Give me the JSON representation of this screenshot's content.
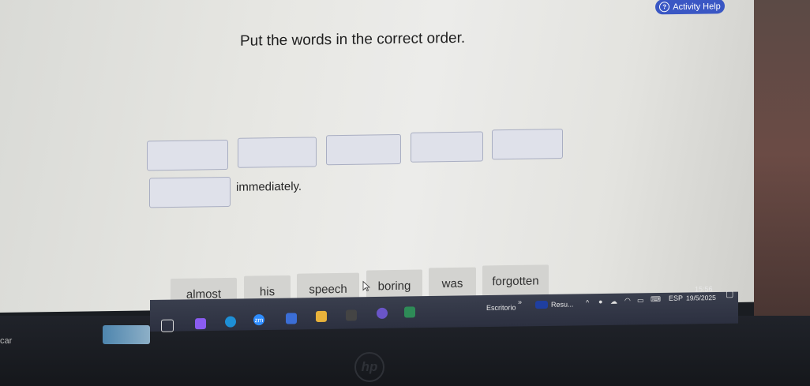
{
  "header": {
    "help_label": "Activity Help",
    "help_icon": "question-circle-icon"
  },
  "activity": {
    "instruction": "Put the words in the correct order.",
    "sentence_tail": "immediately."
  },
  "word_bank": [
    "almost",
    "his",
    "speech",
    "boring",
    "was",
    "forgotten"
  ],
  "taskbar": {
    "label_escritorio": "Escritorio",
    "chevron": "»",
    "label_resu": "Resu...",
    "lang": "ESP",
    "time": "15:56",
    "date": "19/5/2025",
    "zoom_label": "zm"
  },
  "device": {
    "brand": "hp",
    "stray_text": "car"
  },
  "colors": {
    "accent": "#3a57c4",
    "slot_border": "#a9aec2"
  }
}
